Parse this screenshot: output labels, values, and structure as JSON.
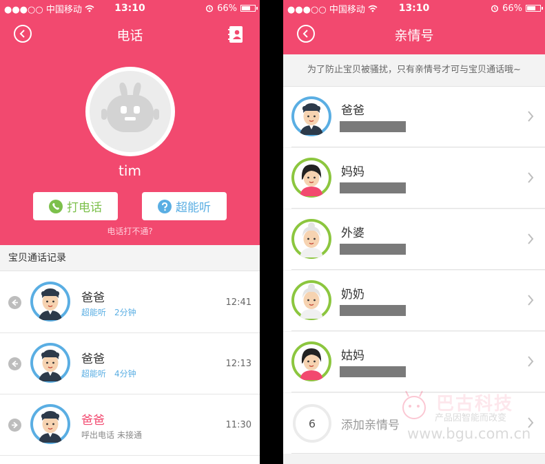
{
  "status_bar": {
    "signal_carrier": "●●●○○ 中国移动",
    "time": "13:10",
    "battery": "66%",
    "battery_fraction": 0.66
  },
  "screen_call": {
    "title": "电话",
    "user_name": "tim",
    "call_button": "打电话",
    "listen_button": "超能听",
    "help_link": "电话打不通?",
    "section_title": "宝贝通话记录",
    "records": [
      {
        "name": "爸爸",
        "type": "超能听",
        "duration": "2分钟",
        "time": "12:41",
        "direction": "incoming",
        "missed": false
      },
      {
        "name": "爸爸",
        "type": "超能听",
        "duration": "4分钟",
        "time": "12:13",
        "direction": "incoming",
        "missed": false
      },
      {
        "name": "爸爸",
        "type": "呼出电话",
        "duration": "未接通",
        "time": "11:30",
        "direction": "outgoing",
        "missed": true
      }
    ]
  },
  "screen_family": {
    "title": "亲情号",
    "notice": "为了防止宝贝被骚扰，只有亲情号才可与宝贝通话哦~",
    "contacts": [
      {
        "name": "爸爸",
        "avatar": "dad",
        "ring_color": "#5aaee3"
      },
      {
        "name": "妈妈",
        "avatar": "mom",
        "ring_color": "#8cc63f"
      },
      {
        "name": "外婆",
        "avatar": "grandma",
        "ring_color": "#8cc63f"
      },
      {
        "name": "奶奶",
        "avatar": "grandma",
        "ring_color": "#8cc63f"
      },
      {
        "name": "姑妈",
        "avatar": "mom",
        "ring_color": "#8cc63f"
      }
    ],
    "add_count": "6",
    "add_label": "添加亲情号"
  },
  "watermark": {
    "brand": "巴古科技",
    "tagline": "产品因智能而改变",
    "url": "www.bgu.com.cn"
  },
  "colors": {
    "accent": "#f2496f",
    "blue": "#5aaee3",
    "green": "#8cc63f",
    "call_green": "#7cc04b"
  }
}
